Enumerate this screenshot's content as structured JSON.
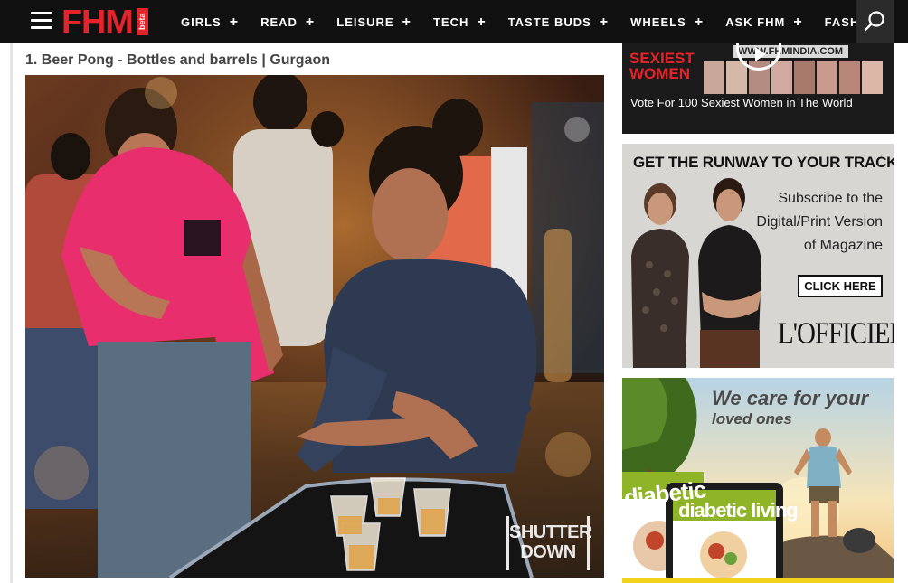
{
  "nav": {
    "logo": "FHM",
    "logo_badge": "beta",
    "items": [
      {
        "label": "GIRLS",
        "has_submenu": true
      },
      {
        "label": "READ",
        "has_submenu": true
      },
      {
        "label": "LEISURE",
        "has_submenu": true
      },
      {
        "label": "TECH",
        "has_submenu": true
      },
      {
        "label": "TASTE BUDS",
        "has_submenu": true
      },
      {
        "label": "WHEELS",
        "has_submenu": true
      },
      {
        "label": "ASK FHM",
        "has_submenu": true
      },
      {
        "label": "FASHION",
        "has_submenu": false
      }
    ],
    "plus_glyph": "+",
    "menu_icon": "hamburger-menu-icon",
    "search_icon": "search-icon"
  },
  "article": {
    "heading": "1. Beer Pong - Bottles and barrels | Gurgaon",
    "photo_watermark_line1": "SHUTTER",
    "photo_watermark_line2": "DOWN"
  },
  "sidebar": {
    "video_ad": {
      "caption": "Vote For 100 Sexiest Women in The World",
      "title_line1": "SEXIEST",
      "title_line2": "WOMEN",
      "url": "WWW.FHMINDIA.COM"
    },
    "runway_ad": {
      "headline": "GET THE RUNWAY TO YOUR TRACK",
      "subscribe": "Subscribe to the Digital/Print Version of Magazine",
      "cta": "CLICK HERE",
      "brand": "L'OFFICIEL"
    },
    "diabetic_ad": {
      "line1": "We care for your",
      "line2": "loved ones",
      "magazine_front": "diabetic",
      "magazine_back": "diabetic living"
    }
  },
  "colors": {
    "brand_red": "#e5232a",
    "navbar_bg": "#111111",
    "heading_gray": "#444444",
    "accent_yellow": "#f2d21a"
  }
}
